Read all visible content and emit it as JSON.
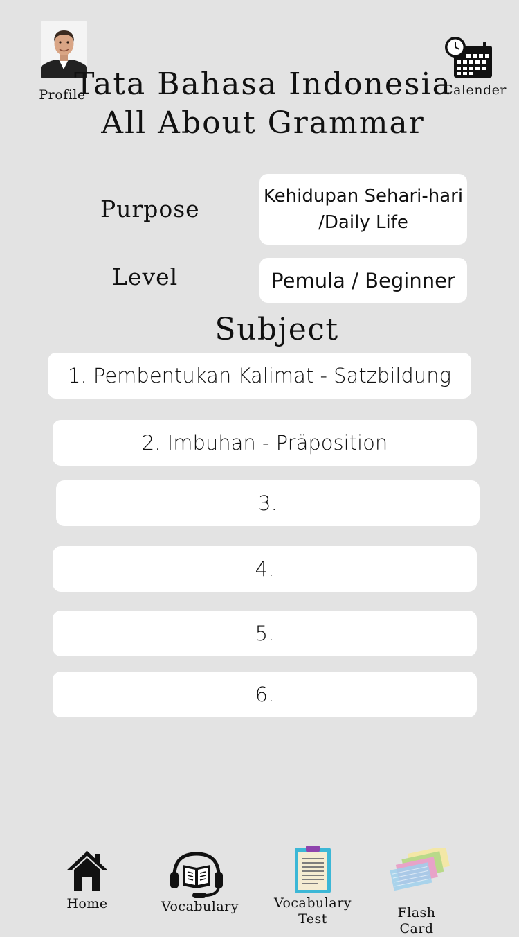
{
  "header": {
    "profile_label": "Profile",
    "calendar_label": "Calender",
    "title_line1": "Tata Bahasa Indonesia",
    "title_line2": "All About Grammar"
  },
  "settings": {
    "purpose_label": "Purpose",
    "purpose_value_line1": "Kehidupan Sehari-hari",
    "purpose_value_line2": "/Daily Life",
    "level_label": "Level",
    "level_value": "Pemula / Beginner"
  },
  "subject": {
    "heading": "Subject",
    "items": [
      "1. Pembentukan Kalimat - Satzbildung",
      "2. Imbuhan - Präposition",
      "3.",
      "4.",
      "5.",
      "6."
    ]
  },
  "nav": {
    "home_label": "Home",
    "vocabulary_label": "Vocabulary",
    "vocab_test_line1": "Vocabulary",
    "vocab_test_line2": "Test",
    "flash_card_label": "Flash Card"
  },
  "icons": {
    "avatar": "profile-photo",
    "calendar": "calendar-clock-icon",
    "home": "home-icon",
    "vocabulary": "book-headset-icon",
    "vocab_test": "clipboard-icon",
    "flash_card": "flash-cards-icon"
  },
  "colors": {
    "background": "#e3e3e3",
    "card": "#ffffff",
    "text": "#111111"
  }
}
